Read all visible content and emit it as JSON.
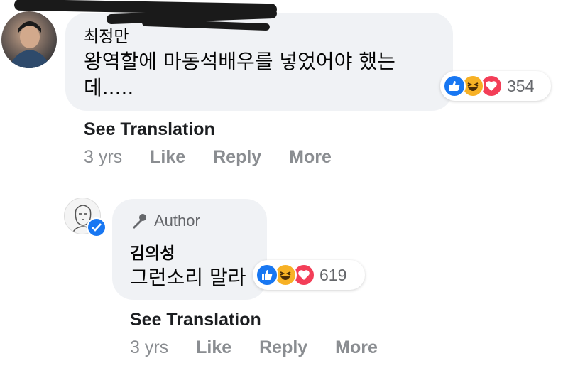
{
  "comment": {
    "author": "최정만",
    "text_line1": "왕역할에 마동석배우를 넣었어야 했는",
    "text_line2": "데.....",
    "reactions": {
      "icons": [
        "like-icon",
        "haha-icon",
        "love-icon"
      ],
      "count": "354"
    },
    "see_translation": "See Translation",
    "time": "3 yrs",
    "like_label": "Like",
    "reply_label": "Reply",
    "more_label": "More"
  },
  "reply": {
    "badge": "Author",
    "author": "김의성",
    "text": "그런소리 말라",
    "reactions": {
      "icons": [
        "like-icon",
        "haha-icon",
        "love-icon"
      ],
      "count": "619"
    },
    "see_translation": "See Translation",
    "time": "3 yrs",
    "like_label": "Like",
    "reply_label": "Reply",
    "more_label": "More"
  },
  "colors": {
    "bubble": "#f0f2f5",
    "like_blue": "#1877f2",
    "love_red": "#f33e58",
    "haha_yellow": "#f7b125",
    "meta_gray": "#8a8d91"
  }
}
